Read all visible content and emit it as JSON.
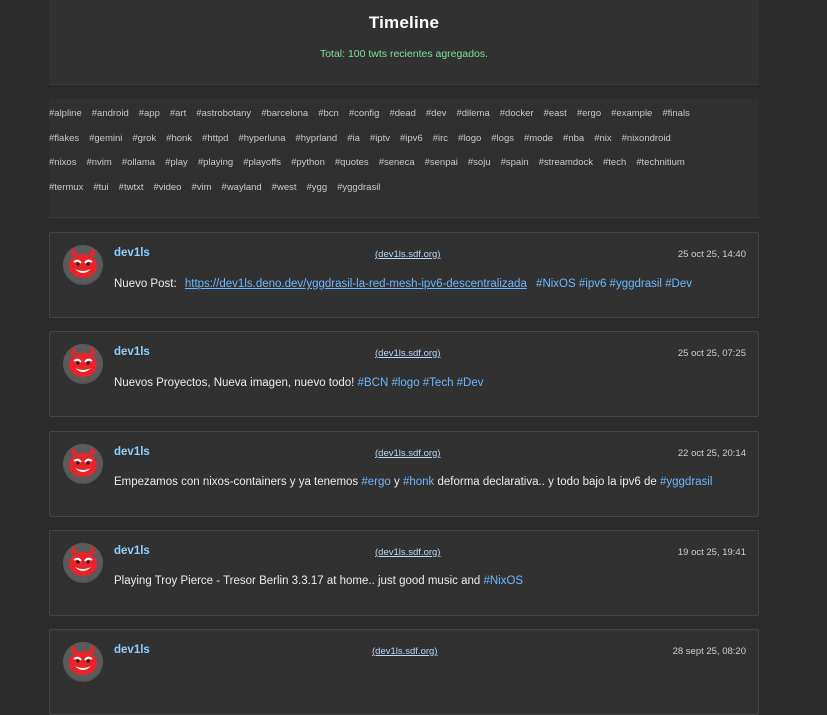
{
  "header": {
    "title": "Timeline",
    "total": "Total: 100 twts recientes agregados."
  },
  "tags": [
    [
      "#alpline",
      "#android",
      "#app",
      "#art",
      "#astrobotany",
      "#barcelona",
      "#bcn",
      "#config",
      "#dead",
      "#dev",
      "#dilema",
      "#docker",
      "#east",
      "#ergo",
      "#example",
      "#finals"
    ],
    [
      "#flakes",
      "#gemini",
      "#grok",
      "#honk",
      "#httpd",
      "#hyperluna",
      "#hyprland",
      "#ia",
      "#iptv",
      "#ipv6",
      "#irc",
      "#logo",
      "#logs",
      "#mode",
      "#nba",
      "#nix",
      "#nixondroid"
    ],
    [
      "#nixos",
      "#nvim",
      "#ollama",
      "#play",
      "#playing",
      "#playoffs",
      "#python",
      "#quotes",
      "#seneca",
      "#senpai",
      "#soju",
      "#spain",
      "#streamdock",
      "#tech",
      "#technitium"
    ],
    [
      "#termux",
      "#tui",
      "#twtxt",
      "#video",
      "#vim",
      "#wayland",
      "#west",
      "#ygg",
      "#yggdrasil"
    ]
  ],
  "posts": [
    {
      "user": "dev1ls",
      "domain": "(dev1ls.sdf.org)",
      "time": "25 oct 25, 14:40",
      "text": "Nuevo Post:",
      "link": "https://dev1ls.deno.dev/yggdrasil-la-red-mesh-ipv6-descentralizada",
      "hashtags": "#NixOS #ipv6 #yggdrasil #Dev"
    },
    {
      "user": "dev1ls",
      "domain": "(dev1ls.sdf.org)",
      "time": "25 oct 25, 07:25",
      "text": "Nuevos Proyectos, Nueva imagen, nuevo todo!",
      "hashtags": "#BCN #logo #Tech #Dev"
    },
    {
      "user": "dev1ls",
      "domain": "(dev1ls.sdf.org)",
      "time": "22 oct 25, 20:14",
      "text_a": "Empezamos con nixos-containers y ya tenemos",
      "tag_a": "#ergo",
      "text_b": "y",
      "tag_b": "#honk",
      "text_c": "deforma declarativa.. y todo bajo la ipv6 de",
      "tag_c": "#yggdrasil"
    },
    {
      "user": "dev1ls",
      "domain": "(dev1ls.sdf.org)",
      "time": "19 oct 25, 19:41",
      "text": "Playing Troy Pierce - Tresor Berlin 3.3.17 at home.. just good music and",
      "hashtags": "#NixOS"
    },
    {
      "user": "dev1ls",
      "domain": "(dev1ls.sdf.org)",
      "time": "28 sept 25, 08:20"
    }
  ],
  "colors": {
    "background": "#2b2b2b",
    "accent_link": "#6cb7ff",
    "username": "#8fd0ff",
    "total_text": "#7ee09a",
    "avatar_face": "#e8232a"
  },
  "icons": {
    "avatar": "red-devil-face-icon"
  }
}
